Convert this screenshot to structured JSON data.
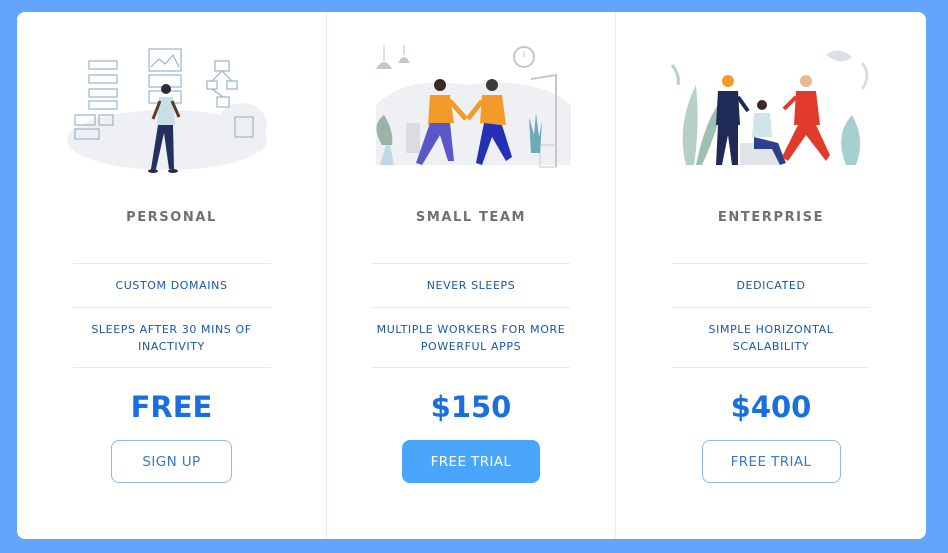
{
  "colors": {
    "page_background": "#64a5fb",
    "card_background": "#ffffff",
    "accent_price": "#1a6fe0",
    "feature_text": "#1a57a8",
    "primary_button": "#4aa6fb"
  },
  "plans": [
    {
      "name": "PERSONAL",
      "illustration": "person-walking-illustration",
      "features": [
        "CUSTOM DOMAINS",
        "SLEEPS AFTER 30 MINS OF INACTIVITY"
      ],
      "price": "FREE",
      "cta": {
        "label": "SIGN UP",
        "style": "outline"
      }
    },
    {
      "name": "SMALL TEAM",
      "illustration": "two-people-meeting-illustration",
      "features": [
        "NEVER SLEEPS",
        "MULTIPLE WORKERS FOR MORE POWERFUL APPS"
      ],
      "price": "$150",
      "cta": {
        "label": "FREE TRIAL",
        "style": "solid"
      }
    },
    {
      "name": "ENTERPRISE",
      "illustration": "group-of-people-illustration",
      "features": [
        "DEDICATED",
        "SIMPLE HORIZONTAL SCALABILITY"
      ],
      "price": "$400",
      "cta": {
        "label": "FREE TRIAL",
        "style": "outline"
      }
    }
  ]
}
